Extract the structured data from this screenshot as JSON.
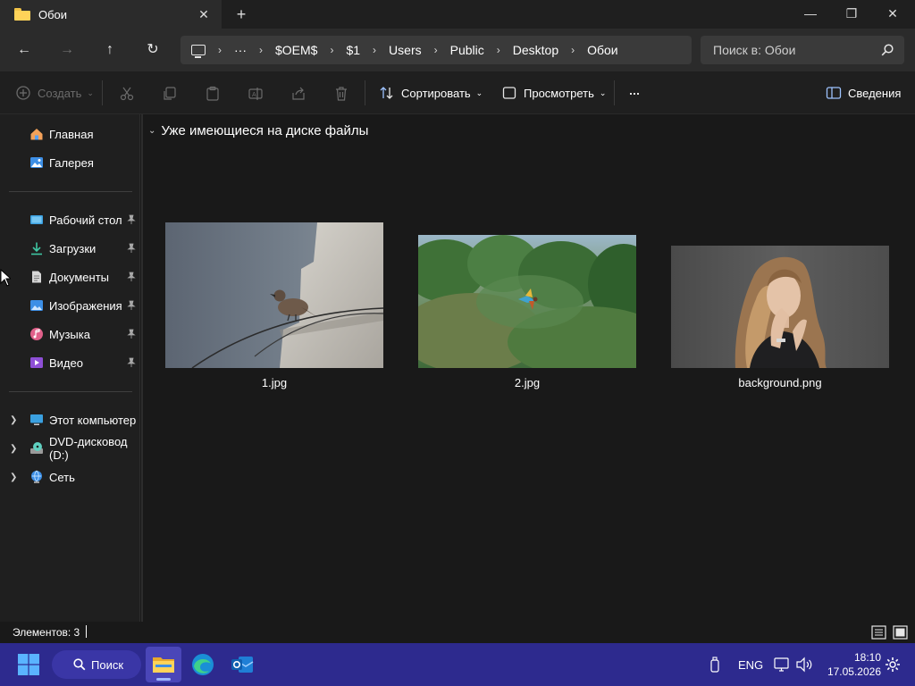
{
  "window": {
    "tab_title": "Обои",
    "close_tab_glyph": "✕",
    "new_tab_glyph": "+",
    "minimize_glyph": "—",
    "maximize_glyph": "❐",
    "close_glyph": "✕"
  },
  "navigation": {
    "back_glyph": "←",
    "forward_glyph": "→",
    "up_glyph": "↑",
    "refresh_glyph": "↻",
    "breadcrumbs": [
      "···",
      "$OEM$",
      "$1",
      "Users",
      "Public",
      "Desktop",
      "Обои"
    ],
    "separator": "›",
    "search_placeholder": "Поиск в: Обои"
  },
  "commandbar": {
    "new_label": "Создать",
    "sort_label": "Сортировать",
    "view_label": "Просмотреть",
    "more_glyph": "···",
    "details_label": "Сведения"
  },
  "sidebar": {
    "home": "Главная",
    "gallery": "Галерея",
    "quick_access": [
      {
        "label": "Рабочий стол",
        "icon": "desktop-icon"
      },
      {
        "label": "Загрузки",
        "icon": "downloads-icon"
      },
      {
        "label": "Документы",
        "icon": "documents-icon"
      },
      {
        "label": "Изображения",
        "icon": "pictures-icon"
      },
      {
        "label": "Музыка",
        "icon": "music-icon"
      },
      {
        "label": "Видео",
        "icon": "videos-icon"
      }
    ],
    "this_pc": "Этот компьютер",
    "dvd": "DVD-дисковод (D:)",
    "network": "Сеть"
  },
  "content": {
    "group_header": "Уже имеющиеся на диске файлы",
    "files": [
      {
        "name": "1.jpg"
      },
      {
        "name": "2.jpg"
      },
      {
        "name": "background.png"
      }
    ]
  },
  "status": {
    "items_count": "Элементов: 3"
  },
  "taskbar": {
    "search_label": "Поиск",
    "language": "ENG",
    "time": "18:10",
    "date": "17.05.2026"
  },
  "colors": {
    "taskbar_bg": "#2d2a8e",
    "window_bg": "#191919",
    "folder_yellow": "#ffd359"
  }
}
